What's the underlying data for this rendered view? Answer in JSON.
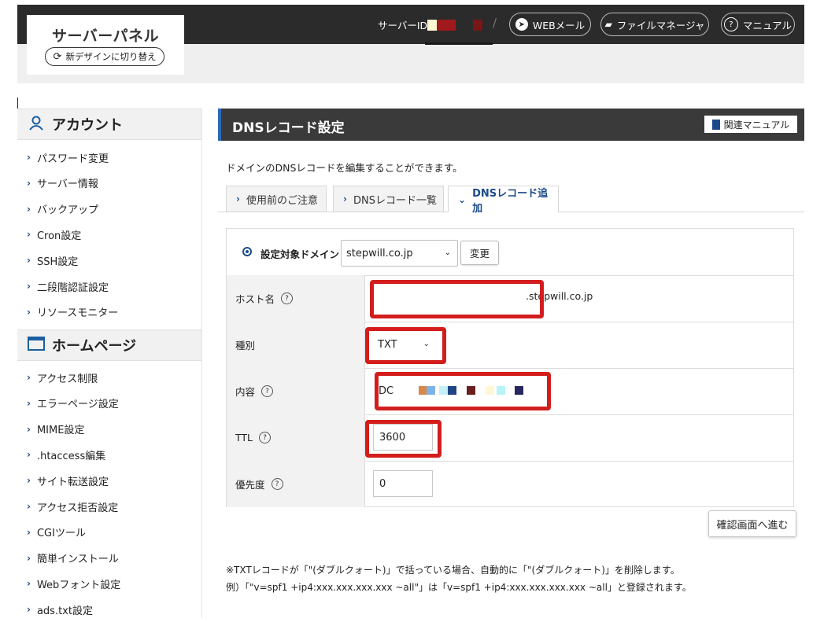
{
  "header": {
    "logo_title": "サーバーパネル",
    "switch_label": "新デザインに切り替え",
    "server_id_label": "サーバーID",
    "separator": "/",
    "webmail_label": "WEBメール",
    "filemanager_label": "ファイルマネージャ",
    "manual_label": "マニュアル"
  },
  "sidebar": {
    "account_heading": "アカウント",
    "account_items": [
      "パスワード変更",
      "サーバー情報",
      "バックアップ",
      "Cron設定",
      "SSH設定",
      "二段階認証設定",
      "リソースモニター"
    ],
    "homepage_heading": "ホームページ",
    "homepage_items": [
      "アクセス制限",
      "エラーページ設定",
      "MIME設定",
      ".htaccess編集",
      "サイト転送設定",
      "アクセス拒否設定",
      "CGIツール",
      "簡単インストール",
      "Webフォント設定",
      "ads.txt設定"
    ]
  },
  "page": {
    "title": "DNSレコード設定",
    "related_manual": "関連マニュアル",
    "description": "ドメインのDNSレコードを編集することができます。",
    "tabs": [
      "使用前のご注意",
      "DNSレコード一覧",
      "DNSレコード追加"
    ],
    "active_tab": 2
  },
  "form": {
    "target_domain_label": "設定対象ドメイン",
    "target_domain_value": "stepwill.co.jp",
    "change_button": "変更",
    "host_label": "ホスト名",
    "host_value": "",
    "host_suffix": ".stepwill.co.jp",
    "type_label": "種別",
    "type_value": "TXT",
    "content_label": "内容",
    "content_value": "DC",
    "ttl_label": "TTL",
    "ttl_value": "3600",
    "priority_label": "優先度",
    "priority_value": "0",
    "confirm_button": "確認画面へ進む"
  },
  "notes": {
    "line1": "※TXTレコードが「\"(ダブルクォート)」で括っている場合、自動的に「\"(ダブルクォート)」を削除します。",
    "line2": "例）「\"v=spf1 +ip4:xxx.xxx.xxx.xxx ~all\"」は「v=spf1 +ip4:xxx.xxx.xxx.xxx ~all」と登録されます。"
  },
  "colors": {
    "accent": "#1a4a8a",
    "highlight": "#d31d1d",
    "header_bg": "#2b2b2b",
    "redaction_colors": [
      "#d8894a",
      "#7fb3e8",
      "#c7eff8",
      "#1f4584",
      "#6b1f1f",
      "#fff6d6",
      "#b8f3f6",
      "#27275e"
    ]
  },
  "icons": {
    "switch": "refresh-icon",
    "webmail": "send-icon",
    "filemanager": "folder-icon",
    "manual": "help-circle-icon",
    "account": "user-icon",
    "homepage": "window-icon",
    "related_manual": "book-icon"
  }
}
